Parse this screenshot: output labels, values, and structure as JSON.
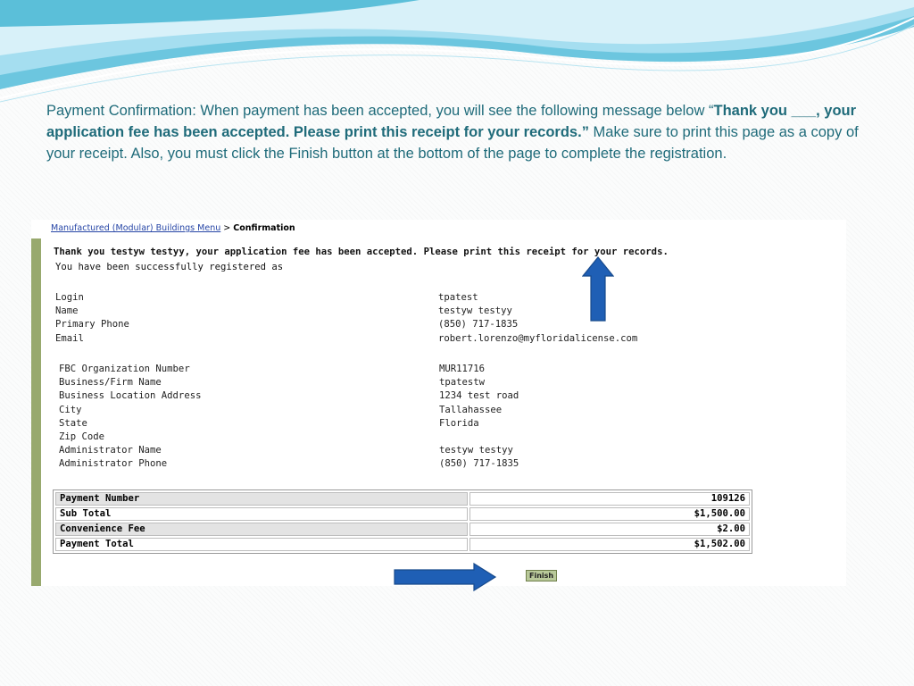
{
  "intro": {
    "lead": "Payment Confirmation: When payment has been accepted, you will see the following message below “",
    "bold": "Thank you ___, your application fee has been accepted. Please print this receipt for your records.”",
    "tail": " Make sure to print this page as a copy of your receipt. Also, you must click the Finish button at the bottom of the page to complete the registration."
  },
  "breadcrumb": {
    "link": "Manufactured (Modular) Buildings Menu",
    "sep": ">",
    "current": "Confirmation"
  },
  "message": {
    "thanks": "Thank you testyw testyy, your application fee has been accepted. Please print this receipt for your records.",
    "registered": "You have been successfully registered as"
  },
  "user": [
    {
      "label": "Login",
      "value": "tpatest"
    },
    {
      "label": "Name",
      "value": "testyw testyy"
    },
    {
      "label": "Primary Phone",
      "value": "(850) 717-1835"
    },
    {
      "label": "Email",
      "value": "robert.lorenzo@myfloridalicense.com"
    }
  ],
  "business": [
    {
      "label": "FBC Organization Number",
      "value": "MUR11716"
    },
    {
      "label": "Business/Firm Name",
      "value": "tpatestw"
    },
    {
      "label": "Business Location Address",
      "value": "1234 test road"
    },
    {
      "label": "City",
      "value": "Tallahassee"
    },
    {
      "label": "State",
      "value": "Florida"
    },
    {
      "label": "Zip Code",
      "value": ""
    },
    {
      "label": "Administrator Name",
      "value": "testyw testyy"
    },
    {
      "label": "Administrator Phone",
      "value": "(850) 717-1835"
    }
  ],
  "payment": [
    {
      "label": "Payment Number",
      "value": "109126"
    },
    {
      "label": "Sub Total",
      "value": "$1,500.00"
    },
    {
      "label": "Convenience Fee",
      "value": "$2.00"
    },
    {
      "label": "Payment Total",
      "value": "$1,502.00"
    }
  ],
  "finish_label": "Finish",
  "icons": {
    "up": "up-arrow-icon",
    "right": "right-arrow-icon"
  },
  "colors": {
    "accent_text": "#1f6b7a",
    "arrow": "#1f5fb5",
    "green_bar": "#98a96e"
  }
}
